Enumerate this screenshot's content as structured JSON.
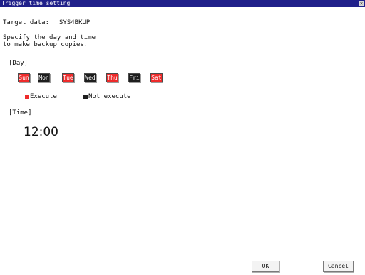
{
  "window": {
    "title": "Trigger time setting",
    "close_glyph": "×",
    "colors": {
      "titlebar": "#20208a",
      "execute": "#ee2b2b",
      "not_execute": "#1e1e1e"
    }
  },
  "target": {
    "label": "Target data:",
    "value": "SYS4BKUP"
  },
  "instructions": [
    "Specify the day and time",
    "to make backup copies."
  ],
  "day_section": {
    "label": "[Day]",
    "days": [
      {
        "label": "Sun",
        "state": "execute"
      },
      {
        "label": "Mon",
        "state": "not-execute"
      },
      {
        "label": "Tue",
        "state": "execute"
      },
      {
        "label": "Wed",
        "state": "not-execute"
      },
      {
        "label": "Thu",
        "state": "execute"
      },
      {
        "label": "Fri",
        "state": "not-execute"
      },
      {
        "label": "Sat",
        "state": "execute"
      }
    ]
  },
  "legend": {
    "execute": "Execute",
    "not_execute": "Not execute"
  },
  "time_section": {
    "label": "[Time]",
    "value": "12:00"
  },
  "buttons": {
    "ok": "OK",
    "cancel": "Cancel"
  }
}
